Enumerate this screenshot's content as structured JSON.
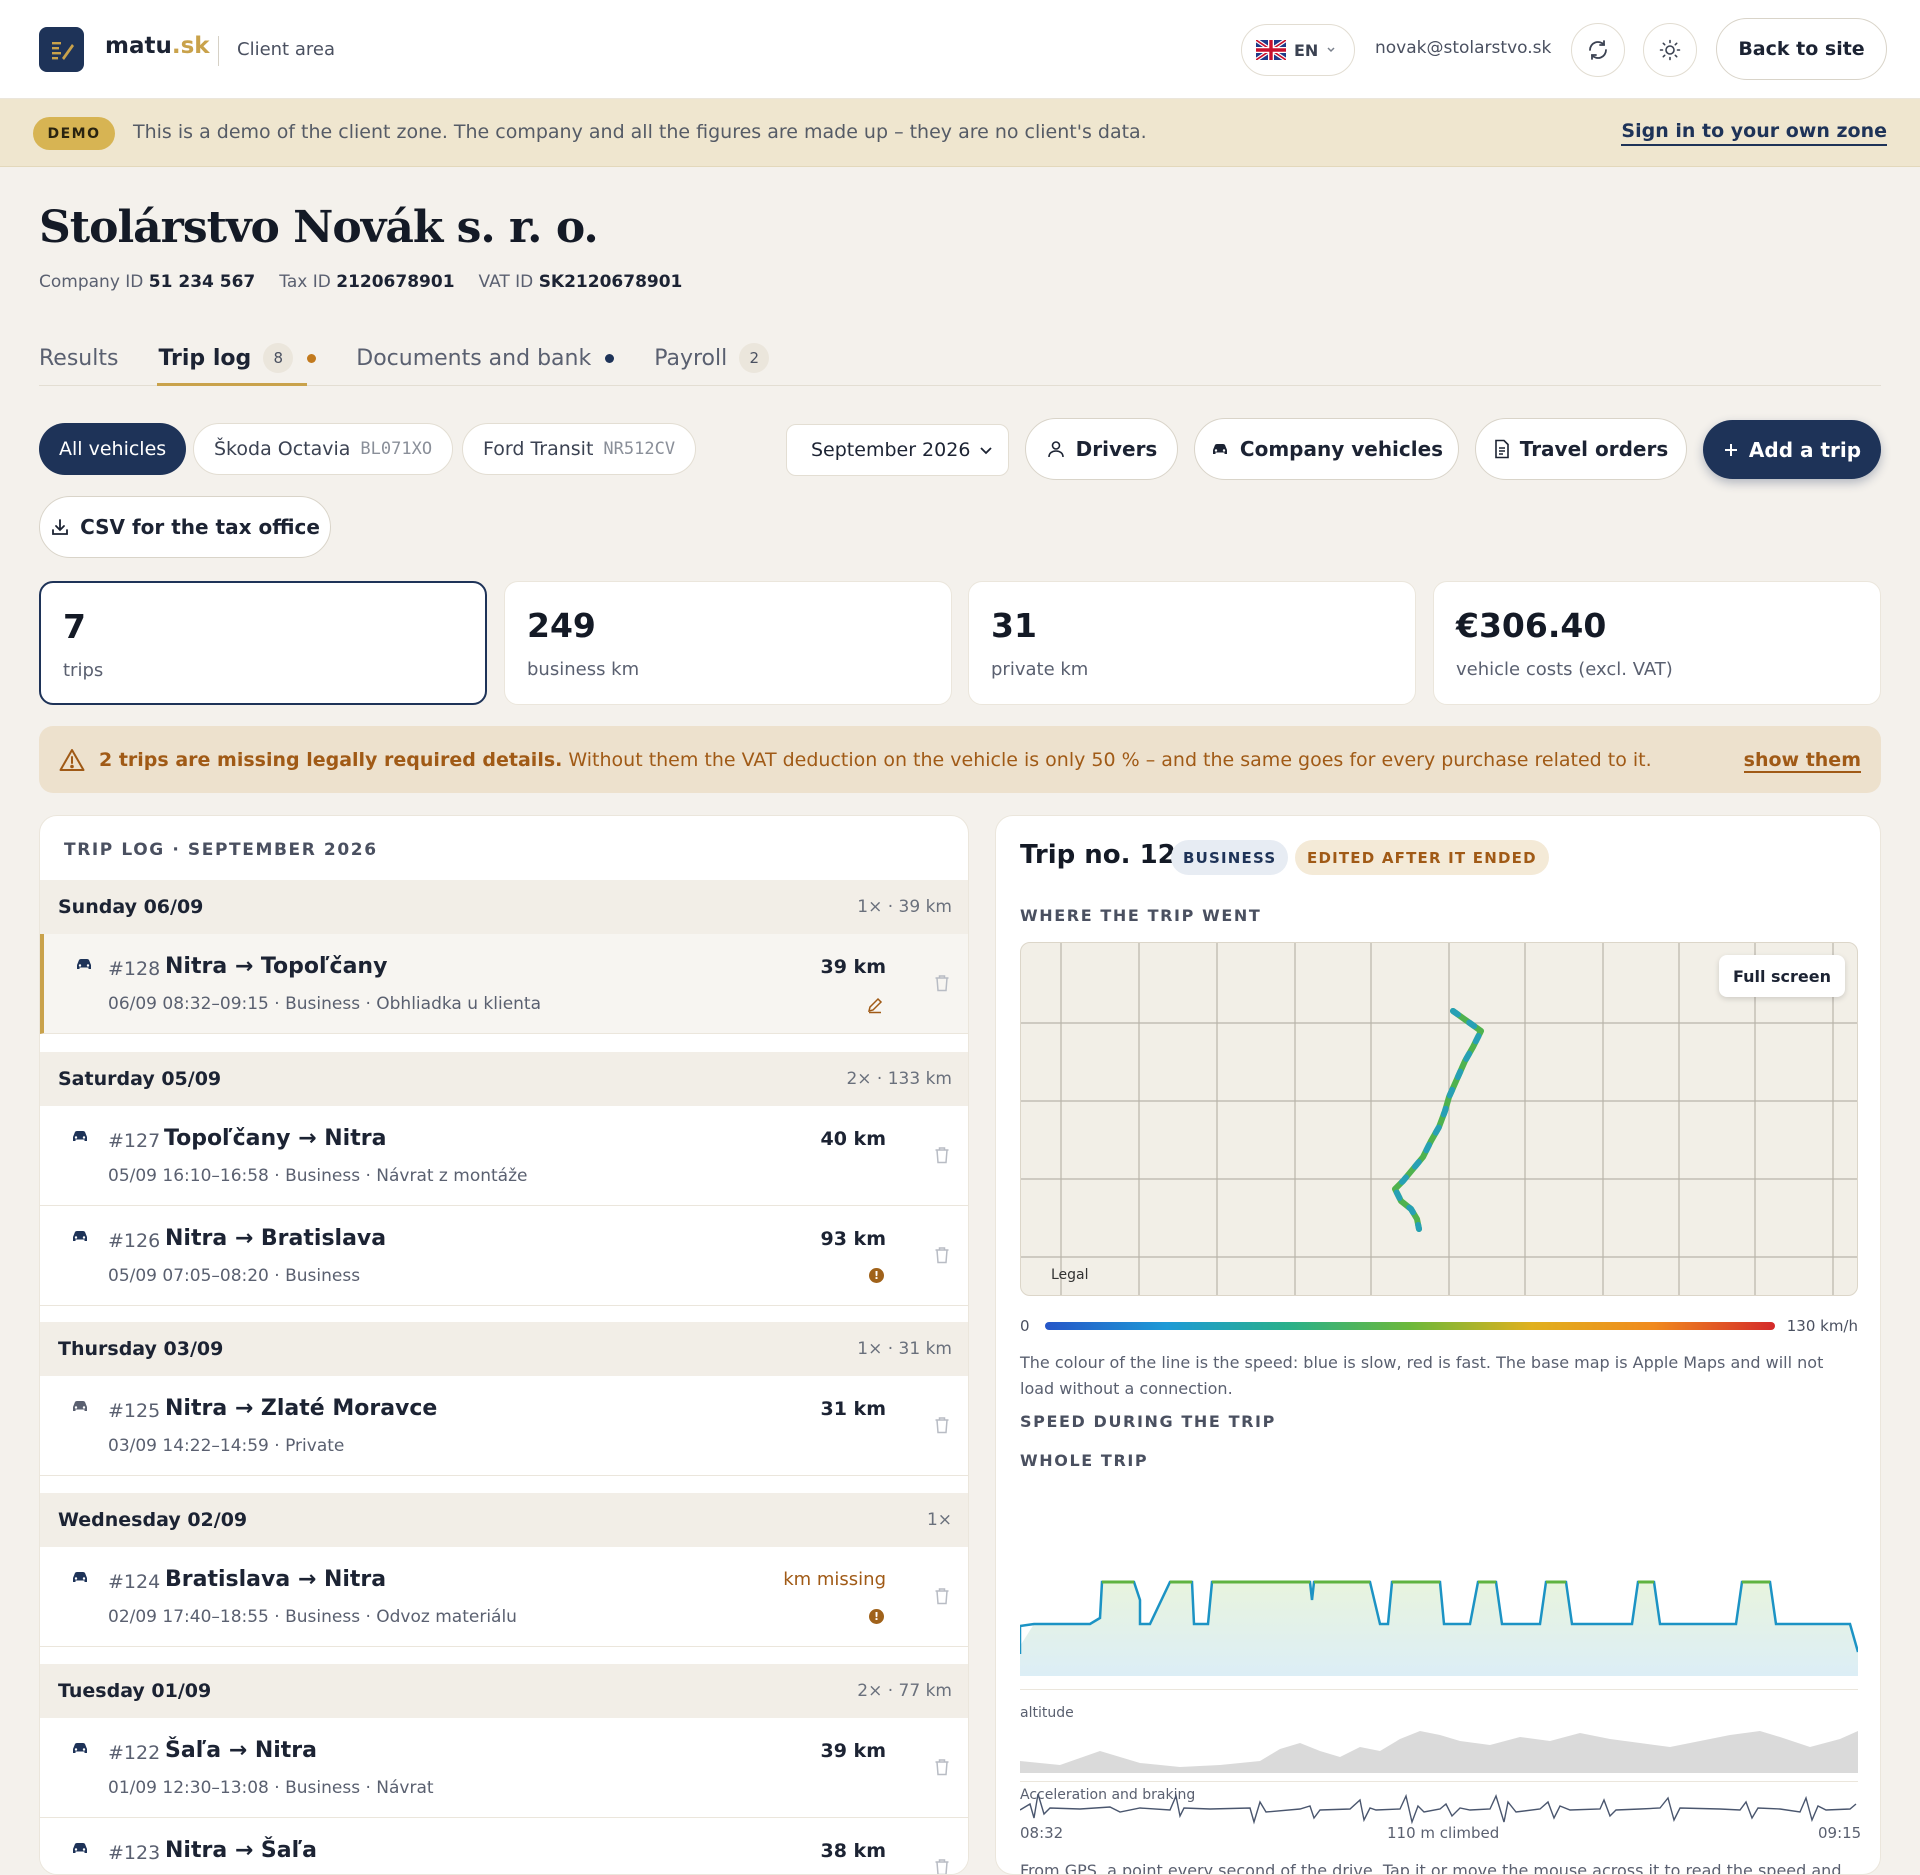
{
  "header": {
    "brand_main": "matu",
    "brand_tld": ".sk",
    "area": "Client area",
    "lang": "EN",
    "email": "novak@stolarstvo.sk",
    "back_label": "Back to site"
  },
  "demo": {
    "badge": "DEMO",
    "text": "This is a demo of the client zone. The company and all the figures are made up – they are no client's data.",
    "link": "Sign in to your own zone"
  },
  "company": {
    "name": "Stolárstvo Novák s. r. o.",
    "company_id_label": "Company ID",
    "company_id": "51 234 567",
    "tax_id_label": "Tax ID",
    "tax_id": "2120678901",
    "vat_id_label": "VAT ID",
    "vat_id": "SK2120678901"
  },
  "tabs": [
    {
      "label": "Results"
    },
    {
      "label": "Trip log",
      "count": "8"
    },
    {
      "label": "Documents and bank"
    },
    {
      "label": "Payroll",
      "count": "2"
    }
  ],
  "filters": {
    "all": "All vehicles",
    "v1_name": "Škoda Octavia",
    "v1_plate": "BL071XO",
    "v2_name": "Ford Transit",
    "v2_plate": "NR512CV",
    "month": "September 2026",
    "drivers": "Drivers",
    "company_vehicles": "Company vehicles",
    "travel_orders": "Travel orders",
    "add_trip": "Add a trip",
    "csv": "CSV for the tax office"
  },
  "stats": [
    {
      "value": "7",
      "label": "trips"
    },
    {
      "value": "249",
      "label": "business km"
    },
    {
      "value": "31",
      "label": "private km"
    },
    {
      "value": "€306.40",
      "label": "vehicle costs (excl. VAT)"
    }
  ],
  "warning": {
    "bold": "2 trips are missing legally required details.",
    "text": " Without them the VAT deduction on the vehicle is only 50 % – and the same goes for every purchase related to it.",
    "link": "show them"
  },
  "log": {
    "title": "TRIP LOG · SEPTEMBER 2026",
    "days": [
      {
        "name": "Sunday 06/09",
        "summary": "1× · 39 km"
      },
      {
        "name": "Saturday 05/09",
        "summary": "2× · 133 km"
      },
      {
        "name": "Thursday 03/09",
        "summary": "1× · 31 km"
      },
      {
        "name": "Wednesday 02/09",
        "summary": "1×"
      },
      {
        "name": "Tuesday 01/09",
        "summary": "2× · 77 km"
      }
    ],
    "trips": [
      {
        "num": "#128",
        "route": "Nitra → Topoľčany",
        "meta": "06/09 08:32–09:15 · Business · Obhliadka u klienta",
        "km": "39 km"
      },
      {
        "num": "#127",
        "route": "Topoľčany → Nitra",
        "meta": "05/09 16:10–16:58 · Business · Návrat z montáže",
        "km": "40 km"
      },
      {
        "num": "#126",
        "route": "Nitra → Bratislava",
        "meta": "05/09 07:05–08:20 · Business",
        "km": "93 km"
      },
      {
        "num": "#125",
        "route": "Nitra → Zlaté Moravce",
        "meta": "03/09 14:22–14:59 · Private",
        "km": "31 km"
      },
      {
        "num": "#124",
        "route": "Bratislava → Nitra",
        "meta": "02/09 17:40–18:55 · Business · Odvoz materiálu",
        "km": "km missing"
      },
      {
        "num": "#122",
        "route": "Šaľa → Nitra",
        "meta": "01/09 12:30–13:08 · Business · Návrat",
        "km": "39 km"
      },
      {
        "num": "#123",
        "route": "Nitra → Šaľa",
        "meta": "",
        "km": "38 km"
      }
    ]
  },
  "detail": {
    "title": "Trip no. 128",
    "badge_business": "BUSINESS",
    "badge_edited": "EDITED AFTER IT ENDED",
    "where": "WHERE THE TRIP WENT",
    "fullscreen": "Full screen",
    "legal": "Legal",
    "speed_min": "0",
    "speed_max": "130 km/h",
    "note": "The colour of the line is the speed: blue is slow, red is fast. The base map is Apple Maps and will not load without a connection.",
    "speed_section": "SPEED DURING THE TRIP",
    "whole_trip": "WHOLE TRIP",
    "altitude": "altitude",
    "accel": "Acceleration and braking",
    "t_start": "08:32",
    "climbed": "110 m climbed",
    "t_end": "09:15",
    "foot": "From GPS, a point every second of the drive. Tap it or move the mouse across it to read the speed and"
  },
  "colors": {
    "navy": "#1e3358",
    "gold": "#c9a24b",
    "warn": "#a05a16"
  }
}
